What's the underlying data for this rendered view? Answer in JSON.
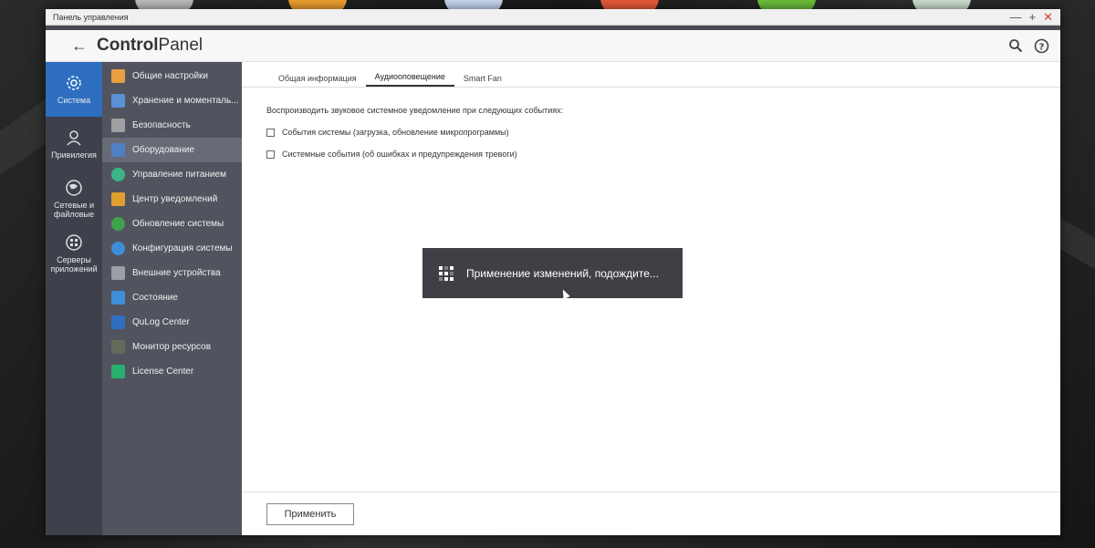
{
  "window": {
    "title": "Панель управления",
    "minimize": "—",
    "maximize": "+",
    "close": "✕"
  },
  "header": {
    "back": "←",
    "brand_bold": "Control",
    "brand_light": "Panel",
    "search_icon": "search-icon",
    "help_icon": "help-icon"
  },
  "rail": [
    {
      "label": "Система",
      "icon": "gear-icon",
      "active": true
    },
    {
      "label": "Привилегия",
      "icon": "user-icon",
      "active": false
    },
    {
      "label": "Сетевые и файловые",
      "icon": "globe-icon",
      "active": false
    },
    {
      "label": "Серверы приложений",
      "icon": "apps-icon",
      "active": false
    }
  ],
  "subnav": [
    {
      "label": "Общие настройки",
      "color": "#e8a040"
    },
    {
      "label": "Хранение и моменталь...",
      "color": "#5b8fd6"
    },
    {
      "label": "Безопасность",
      "color": "#a0a0a0"
    },
    {
      "label": "Оборудование",
      "color": "#4f7fc4",
      "active": true
    },
    {
      "label": "Управление питанием",
      "color": "#3cb48a"
    },
    {
      "label": "Центр уведомлений",
      "color": "#e0a030"
    },
    {
      "label": "Обновление системы",
      "color": "#3fa34d"
    },
    {
      "label": "Конфигурация системы",
      "color": "#3c8fd8"
    },
    {
      "label": "Внешние устройства",
      "color": "#9aa0a6"
    },
    {
      "label": "Состояние",
      "color": "#3c8fd8"
    },
    {
      "label": "QuLog Center",
      "color": "#2e6fc0"
    },
    {
      "label": "Монитор ресурсов",
      "color": "#666a5a"
    },
    {
      "label": "License Center",
      "color": "#28b070"
    }
  ],
  "tabs": [
    {
      "label": "Общая информация",
      "active": false
    },
    {
      "label": "Аудиооповещение",
      "active": true
    },
    {
      "label": "Smart Fan",
      "active": false
    }
  ],
  "pane": {
    "description": "Воспроизводить звуковое системное уведомление при следующих событиях:",
    "options": [
      {
        "label": "События системы (загрузка, обновление микропрограммы)",
        "checked": false
      },
      {
        "label": "Системные события (об ошибках и предупреждения тревоги)",
        "checked": false
      }
    ]
  },
  "footer": {
    "apply_label": "Применить"
  },
  "toast": {
    "message": "Применение изменений, подождите..."
  }
}
